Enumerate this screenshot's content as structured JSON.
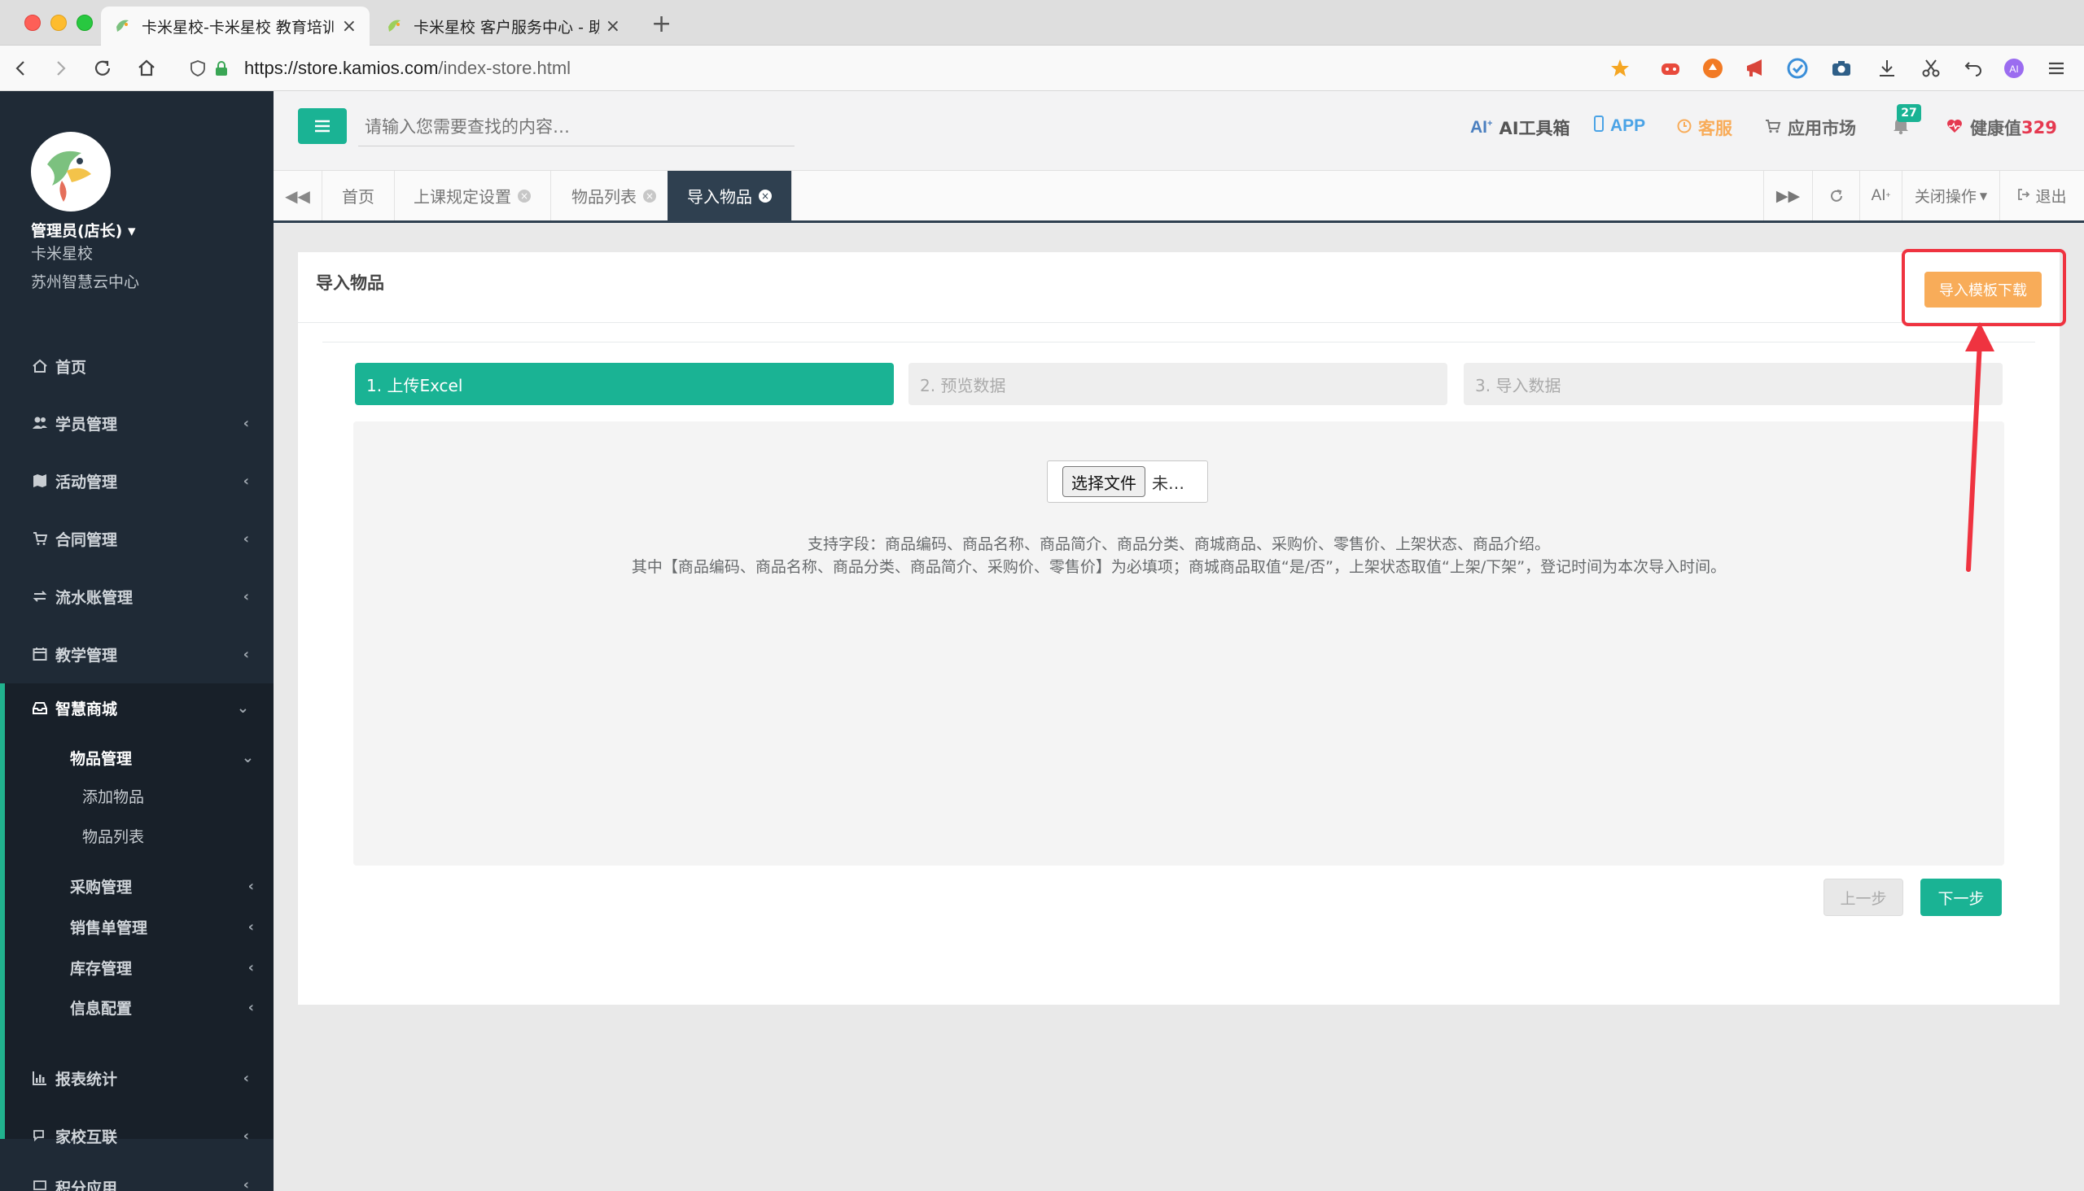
{
  "browser": {
    "tabs": [
      {
        "title": "卡米星校-卡米星校 教育培训机构",
        "active": true
      },
      {
        "title": "卡米星校 客户服务中心 - 助力",
        "active": false
      }
    ],
    "url_host": "https://store.kamios.com",
    "url_path": "/index-store.html"
  },
  "sidebar": {
    "user_name": "管理员(店长)",
    "school": "卡米星校",
    "center": "苏州智慧云中心",
    "menu": [
      {
        "label": "首页",
        "icon": "home-icon"
      },
      {
        "label": "学员管理",
        "icon": "users-icon"
      },
      {
        "label": "活动管理",
        "icon": "map-icon"
      },
      {
        "label": "合同管理",
        "icon": "cart-icon"
      },
      {
        "label": "流水账管理",
        "icon": "exchange-icon"
      },
      {
        "label": "教学管理",
        "icon": "calendar-icon"
      },
      {
        "label": "智慧商城",
        "icon": "inbox-icon"
      }
    ],
    "mall_submenu": {
      "goods_mgmt": "物品管理",
      "goods_children": [
        "添加物品",
        "物品列表"
      ],
      "others": [
        "采购管理",
        "销售单管理",
        "库存管理",
        "信息配置"
      ]
    },
    "bottom_menu": [
      {
        "label": "报表统计",
        "icon": "bar-chart-icon"
      },
      {
        "label": "家校互联",
        "icon": "comments-icon"
      },
      {
        "label": "积分应用",
        "icon": "gift-icon"
      }
    ]
  },
  "header": {
    "search_placeholder": "请输入您需要查找的内容…",
    "ai_tools": "AI工具箱",
    "app": "APP",
    "service": "客服",
    "app_market": "应用市场",
    "notifications": "27",
    "health_label": "健康值",
    "health_value": "329"
  },
  "page_tabs": [
    {
      "label": "首页",
      "closable": false
    },
    {
      "label": "上课规定设置",
      "closable": true
    },
    {
      "label": "物品列表",
      "closable": true
    },
    {
      "label": "导入物品",
      "closable": true,
      "active": true
    }
  ],
  "tab_tools": {
    "ai": "AI",
    "close_ops": "关闭操作",
    "logout": "退出"
  },
  "panel": {
    "title": "导入物品",
    "download_btn": "导入模板下载",
    "steps": [
      "1. 上传Excel",
      "2. 预览数据",
      "3. 导入数据"
    ],
    "file_btn": "选择文件",
    "file_none": "未…",
    "hint_line1": "支持字段：商品编码、商品名称、商品简介、商品分类、商城商品、采购价、零售价、上架状态、商品介绍。",
    "hint_line2": "其中【商品编码、商品名称、商品分类、商品简介、采购价、零售价】为必填项；商城商品取值“是/否”，上架状态取值“上架/下架”，登记时间为本次导入时间。",
    "prev_btn": "上一步",
    "next_btn": "下一步"
  },
  "colors": {
    "accent": "#1ab394",
    "sidebar_bg": "#1f2a36",
    "warning": "#f8ac59",
    "annotation": "#ef3340"
  }
}
